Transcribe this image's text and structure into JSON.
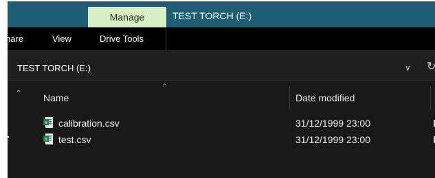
{
  "titlebar": {
    "manage_tab": "Manage",
    "title": "TEST TORCH (E:)"
  },
  "ribbon": {
    "tabs": [
      "hare",
      "View",
      "Drive Tools"
    ]
  },
  "address": {
    "path": "TEST TORCH (E:)"
  },
  "file_list": {
    "columns": [
      "Name",
      "Date modified"
    ],
    "files": [
      {
        "name": "calibration.csv",
        "date_modified": "31/12/1999 23:00",
        "icon": "excel-csv-icon"
      },
      {
        "name": "test.csv",
        "date_modified": "31/12/1999 23:00",
        "icon": "excel-csv-icon"
      }
    ]
  },
  "colors": {
    "titlebar_bg": "#1d5e74",
    "manage_tab_bg": "#d8eec4",
    "ribbon_bg": "#000000",
    "content_bg": "#191919",
    "excel_green": "#1f7a43"
  }
}
